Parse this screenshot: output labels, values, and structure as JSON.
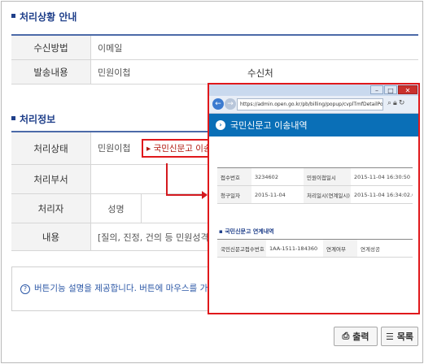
{
  "section1": {
    "title": "처리상황 안내"
  },
  "receive": {
    "method_label": "수신방법",
    "method_value": "이메일",
    "content_label": "발송내용",
    "content_value": "민원이첩",
    "recipient_label": "수신처"
  },
  "section2": {
    "title": "처리정보"
  },
  "process": {
    "status_label": "처리상태",
    "status_value": "민원이첩",
    "transfer_link": "국민신문고 이송내역",
    "dept_label": "처리부서",
    "handler_label": "처리자",
    "handler_sub": "성명",
    "content_label": "내용",
    "content_value": "[질의, 진정, 건의 등 민원성격의 청구"
  },
  "notice": {
    "text": "버튼기능 설명을 제공합니다. 버튼에 마우스를 가져가면 설명"
  },
  "buttons": {
    "print": "출력",
    "list": "목록"
  },
  "popup": {
    "url": "https://admin.open.go.kr/pb/billing/popup/cvplTmfDetailPop",
    "header": "국민신문고 이송내역",
    "row1": {
      "l1": "접수번호",
      "v1": "3234602",
      "l2": "민원이첩일시",
      "v2": "2015-11-04 16:30:50"
    },
    "row2": {
      "l1": "청구일자",
      "v1": "2015-11-04",
      "l2": "처리일시(연계일시)",
      "v2": "2015-11-04 16:34:02.0"
    },
    "sub_title": "국민신문고 연계내역",
    "row3": {
      "l1": "국민신문고접수번호",
      "v1": "1AA-1511-184360",
      "l2": "연계여부",
      "v2": "연계성공"
    }
  },
  "colors": {
    "accent": "#1f3f8a",
    "highlight": "#e0181b",
    "popup_header": "#0a6fb7"
  }
}
